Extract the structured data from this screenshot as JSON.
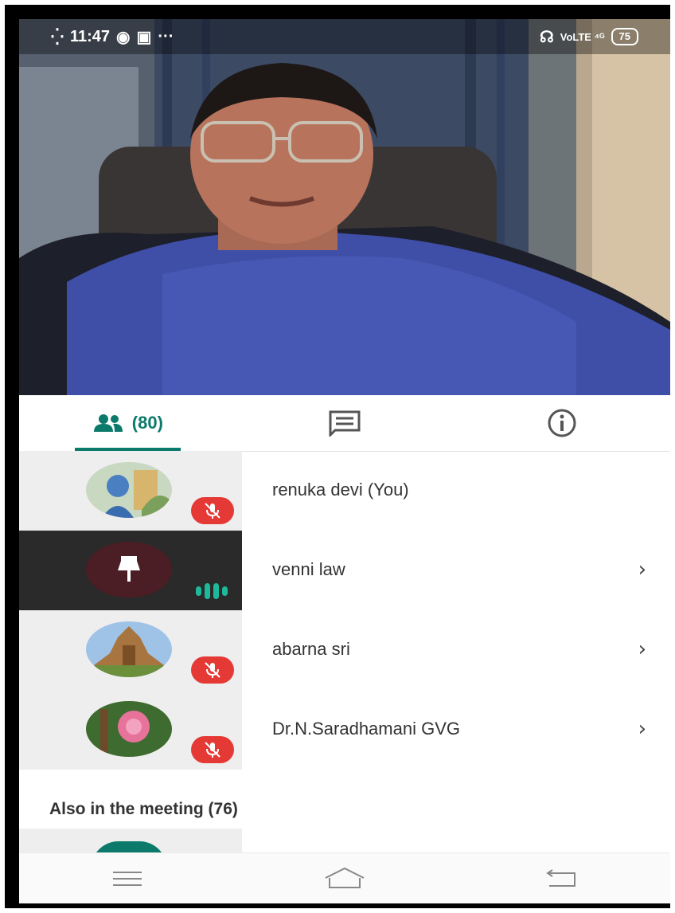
{
  "status_bar": {
    "time": "11:47",
    "battery": "75"
  },
  "tabs": {
    "people_count": "(80)",
    "people_icon": "people-icon",
    "chat_icon": "chat-icon",
    "info_icon": "info-icon"
  },
  "participants": [
    {
      "name": "renuka devi (You)",
      "state": "muted"
    },
    {
      "name": "venni law",
      "state": "speaking",
      "pinned": true
    },
    {
      "name": "abarna sri",
      "state": "muted"
    },
    {
      "name": "Dr.N.Saradhamani GVG",
      "state": "muted"
    }
  ],
  "also_in_meeting": "Also in the meeting (76)",
  "nav": {
    "menu_icon": "menu-icon",
    "home_icon": "home-icon",
    "back_icon": "back-icon"
  },
  "colors": {
    "accent": "#0b7a6b",
    "mute": "#e53935",
    "speaking": "#1db99a"
  }
}
